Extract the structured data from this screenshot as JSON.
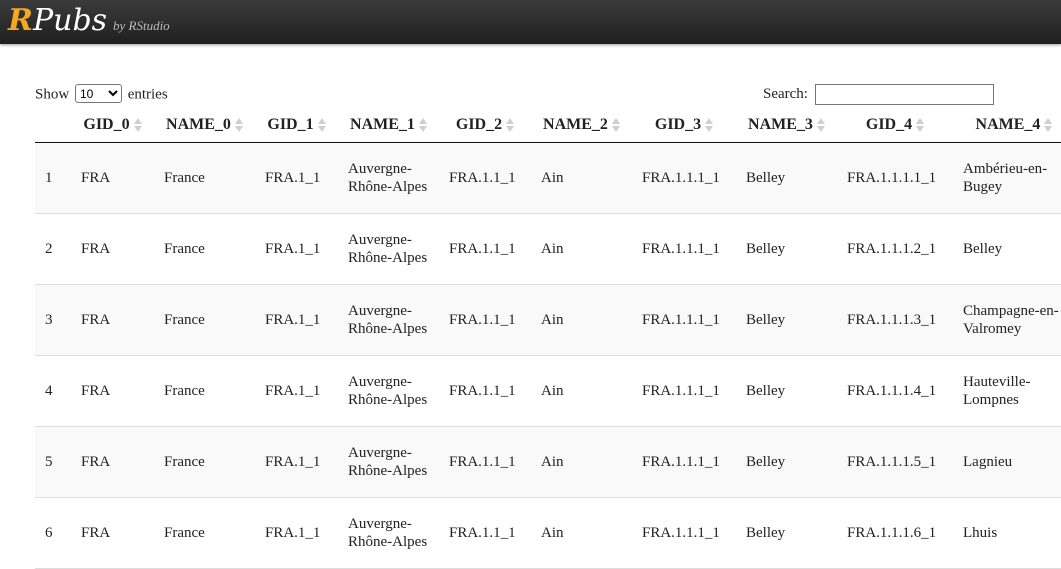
{
  "header": {
    "logo_r": "R",
    "logo_pubs": "Pubs",
    "byline": "by RStudio"
  },
  "controls": {
    "show_label": "Show",
    "entries_label": "entries",
    "page_length": "10",
    "search_label": "Search:",
    "search_value": ""
  },
  "table": {
    "columns": [
      "",
      "GID_0",
      "NAME_0",
      "GID_1",
      "NAME_1",
      "GID_2",
      "NAME_2",
      "GID_3",
      "NAME_3",
      "GID_4",
      "NAME_4"
    ],
    "rows": [
      [
        "1",
        "FRA",
        "France",
        "FRA.1_1",
        "Auvergne-Rhône-Alpes",
        "FRA.1.1_1",
        "Ain",
        "FRA.1.1.1_1",
        "Belley",
        "FRA.1.1.1.1_1",
        "Ambérieu-en-Bugey"
      ],
      [
        "2",
        "FRA",
        "France",
        "FRA.1_1",
        "Auvergne-Rhône-Alpes",
        "FRA.1.1_1",
        "Ain",
        "FRA.1.1.1_1",
        "Belley",
        "FRA.1.1.1.2_1",
        "Belley"
      ],
      [
        "3",
        "FRA",
        "France",
        "FRA.1_1",
        "Auvergne-Rhône-Alpes",
        "FRA.1.1_1",
        "Ain",
        "FRA.1.1.1_1",
        "Belley",
        "FRA.1.1.1.3_1",
        "Champagne-en-Valromey"
      ],
      [
        "4",
        "FRA",
        "France",
        "FRA.1_1",
        "Auvergne-Rhône-Alpes",
        "FRA.1.1_1",
        "Ain",
        "FRA.1.1.1_1",
        "Belley",
        "FRA.1.1.1.4_1",
        "Hauteville-Lompnes"
      ],
      [
        "5",
        "FRA",
        "France",
        "FRA.1_1",
        "Auvergne-Rhône-Alpes",
        "FRA.1.1_1",
        "Ain",
        "FRA.1.1.1_1",
        "Belley",
        "FRA.1.1.1.5_1",
        "Lagnieu"
      ],
      [
        "6",
        "FRA",
        "France",
        "FRA.1_1",
        "Auvergne-Rhône-Alpes",
        "FRA.1.1_1",
        "Ain",
        "FRA.1.1.1_1",
        "Belley",
        "FRA.1.1.1.6_1",
        "Lhuis"
      ]
    ]
  }
}
